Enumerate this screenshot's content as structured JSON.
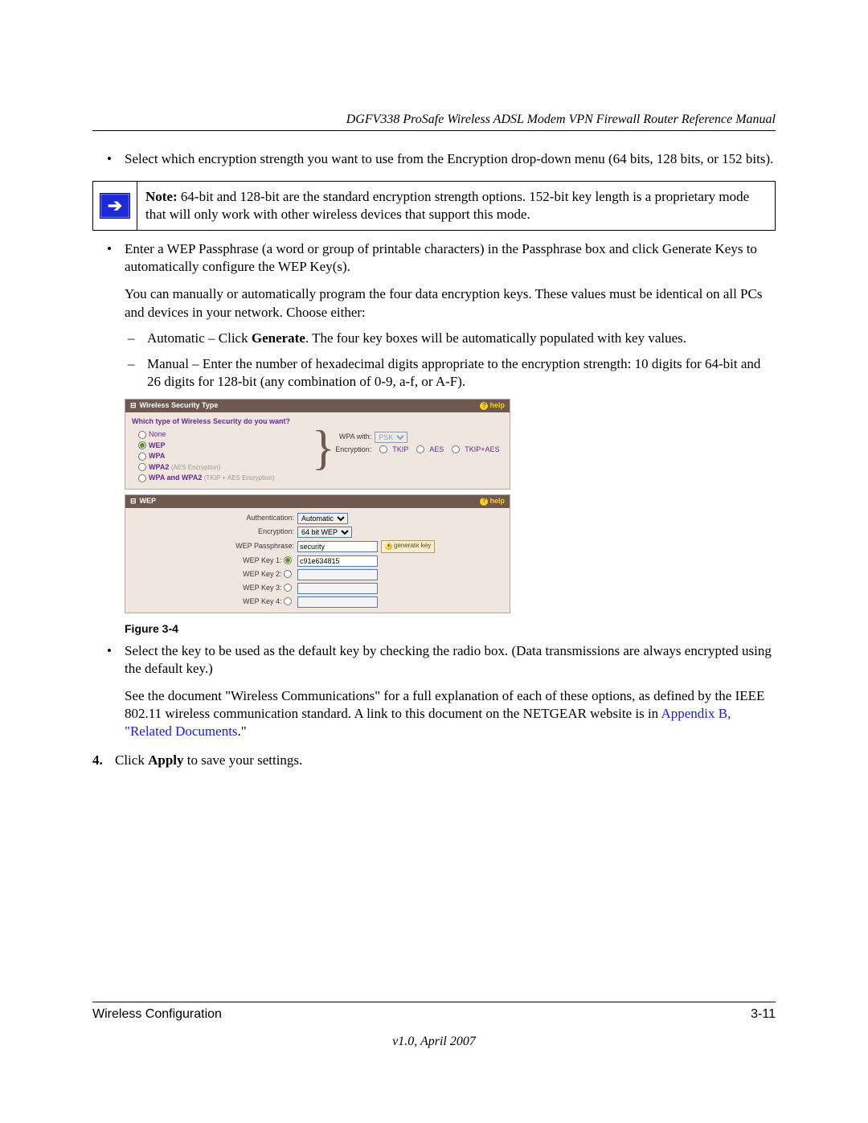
{
  "header": {
    "title": "DGFV338 ProSafe Wireless ADSL Modem VPN Firewall Router Reference Manual"
  },
  "bullets": {
    "b1": "Select which encryption strength you want to use from the Encryption drop-down menu (64 bits, 128 bits, or 152 bits).",
    "b2": "Enter a WEP Passphrase (a word or group of printable characters) in the Passphrase box and click Generate Keys to automatically configure the WEP Key(s).",
    "b3": "Select the key to be used as the default key by checking the radio box. (Data transmissions are always encrypted using the default key.)"
  },
  "note": {
    "label": "Note:",
    "text": " 64-bit and 128-bit are the standard encryption strength options. 152-bit key length is a proprietary mode that will only work with other wireless devices that support this mode."
  },
  "para1": "You can manually or automatically program the four data encryption keys. These values must be identical on all PCs and devices in your network. Choose either:",
  "dashes": {
    "d1_pre": "Automatic – Click ",
    "d1_bold": "Generate",
    "d1_post": ". The four key boxes will be automatically populated with key values.",
    "d2": "Manual – Enter the number of hexadecimal digits appropriate to the encryption strength: 10 digits for 64-bit and 26 digits for 128-bit (any combination of 0-9, a-f, or A-F)."
  },
  "figure": {
    "sec_panel": {
      "title": "Wireless Security Type",
      "help": "help",
      "question": "Which type of Wireless Security do you want?",
      "opts": {
        "none": "None",
        "wep": "WEP",
        "wpa": "WPA",
        "wpa2": "WPA2",
        "wpa2_note": "(AES Encryption)",
        "wpa_wpa2": "WPA and WPA2",
        "wpa_wpa2_note": "(TKIP + AES Encryption)"
      },
      "right": {
        "wpa_with": "WPA with:",
        "wpa_sel": "PSK",
        "enc": "Encryption:",
        "tkip": "TKIP",
        "aes": "AES",
        "tkip_aes": "TKIP+AES"
      }
    },
    "wep_panel": {
      "title": "WEP",
      "help": "help",
      "auth_lbl": "Authentication:",
      "auth_val": "Automatic",
      "enc_lbl": "Encryption:",
      "enc_val": "64 bit WEP",
      "pass_lbl": "WEP Passphrase:",
      "pass_val": "security",
      "gen_btn": "generate key",
      "key1_lbl": "WEP Key 1:",
      "key1_val": "c91e634815",
      "key2_lbl": "WEP Key 2:",
      "key2_val": "",
      "key3_lbl": "WEP Key 3:",
      "key3_val": "",
      "key4_lbl": "WEP Key 4:",
      "key4_val": ""
    }
  },
  "figure_caption": "Figure 3-4",
  "para_see_pre": "See the document \"Wireless Communications\" for a full explanation of each of these options, as defined by the IEEE 802.11 wireless communication standard. A link to this document on the NETGEAR website is in ",
  "para_see_link": "Appendix B, \"Related Documents",
  "para_see_post": ".\"",
  "step4": {
    "num": "4.",
    "pre": "Click ",
    "bold": "Apply",
    "post": " to save your settings."
  },
  "footer": {
    "left": "Wireless Configuration",
    "right": "3-11",
    "center": "v1.0, April 2007"
  }
}
